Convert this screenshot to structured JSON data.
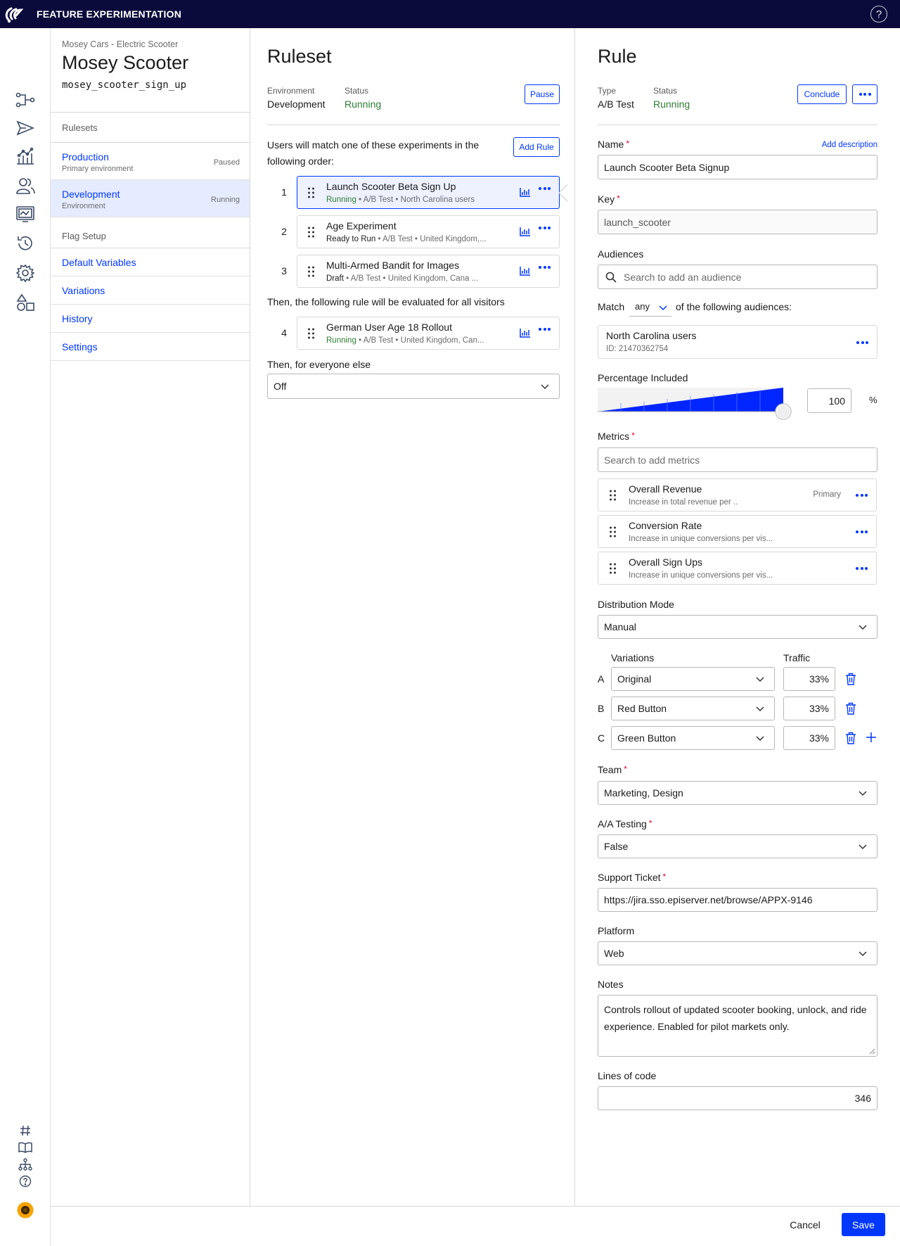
{
  "app": {
    "title": "FEATURE EXPERIMENTATION",
    "help": "?"
  },
  "flag": {
    "project": "Mosey Cars - Electric Scooter",
    "name": "Mosey Scooter",
    "key": "mosey_scooter_sign_up"
  },
  "sidebar": {
    "rulesets_header": "Rulesets",
    "rulesets": [
      {
        "name": "Production",
        "sub": "Primary environment",
        "state": "Paused"
      },
      {
        "name": "Development",
        "sub": "Environment",
        "state": "Running"
      }
    ],
    "flag_setup_header": "Flag Setup",
    "links": [
      "Default Variables",
      "Variations",
      "History",
      "Settings"
    ]
  },
  "ruleset": {
    "title": "Ruleset",
    "env_label": "Environment",
    "env_value": "Development",
    "status_label": "Status",
    "status_value": "Running",
    "pause_label": "Pause",
    "intro": "Users will match one of these experiments in the following order:",
    "add_rule_label": "Add Rule",
    "rules": [
      {
        "num": "1",
        "title": "Launch Scooter Beta Sign Up",
        "status": "Running",
        "meta": " • A/B Test • North Carolina users"
      },
      {
        "num": "2",
        "title": "Age Experiment",
        "status": "Ready to Run",
        "meta": " • A/B Test • United Kingdom,..."
      },
      {
        "num": "3",
        "title": "Multi-Armed Bandit for Images",
        "status": "Draft",
        "meta": " • A/B Test • United Kingdom, Cana ..."
      }
    ],
    "then_all": "Then, the following rule will be evaluated for all visitors",
    "rollout": {
      "num": "4",
      "title": "German User Age 18 Rollout",
      "status": "Running",
      "meta": " • A/B Test • United Kingdom, Can..."
    },
    "then_else": "Then, for everyone else",
    "else_value": "Off"
  },
  "rule": {
    "title": "Rule",
    "type_label": "Type",
    "type_value": "A/B Test",
    "status_label": "Status",
    "status_value": "Running",
    "conclude_label": "Conclude",
    "name_label": "Name",
    "add_description": "Add description",
    "name_value": "Launch Scooter Beta Signup",
    "key_label": "Key",
    "key_value": "launch_scooter",
    "audiences_label": "Audiences",
    "audience_placeholder": "Search to add an audience",
    "match_prefix": "Match",
    "match_value": "any",
    "match_suffix": "of the following audiences:",
    "audience": {
      "name": "North Carolina users",
      "id": "ID: 21470362754"
    },
    "percentage_label": "Percentage Included",
    "percentage_value": "100",
    "percentage_fraction": 1.0,
    "percent_sign": "%",
    "metrics_label": "Metrics",
    "metrics_placeholder": "Search to add metrics",
    "metrics": [
      {
        "name": "Overall Revenue",
        "desc": "Increase in total revenue per ..",
        "tag": "Primary"
      },
      {
        "name": "Conversion Rate",
        "desc": "Increase in unique conversions per vis...",
        "tag": ""
      },
      {
        "name": "Overall Sign Ups",
        "desc": "Increase in unique conversions per vis...",
        "tag": ""
      }
    ],
    "distribution_label": "Distribution Mode",
    "distribution_value": "Manual",
    "variations_header": "Variations",
    "traffic_header": "Traffic",
    "variations": [
      {
        "letter": "A",
        "name": "Original",
        "traffic": "33%"
      },
      {
        "letter": "B",
        "name": "Red Button",
        "traffic": "33%"
      },
      {
        "letter": "C",
        "name": "Green Button",
        "traffic": "33%"
      }
    ],
    "team_label": "Team",
    "team_value": "Marketing, Design",
    "aa_label": "A/A Testing",
    "aa_value": "False",
    "ticket_label": "Support Ticket",
    "ticket_value": "https://jira.sso.episerver.net/browse/APPX-9146",
    "platform_label": "Platform",
    "platform_value": "Web",
    "notes_label": "Notes",
    "notes_value": "Controls rollout of updated scooter booking, unlock, and ride experience. Enabled for pilot markets only.",
    "loc_label": "Lines of code",
    "loc_value": "346",
    "required_mark": "*"
  },
  "footer": {
    "cancel": "Cancel",
    "save": "Save"
  },
  "colors": {
    "accent": "#0037ff",
    "topbar": "#0b0b3b",
    "running": "#2e7d32",
    "required": "#e0002a"
  }
}
